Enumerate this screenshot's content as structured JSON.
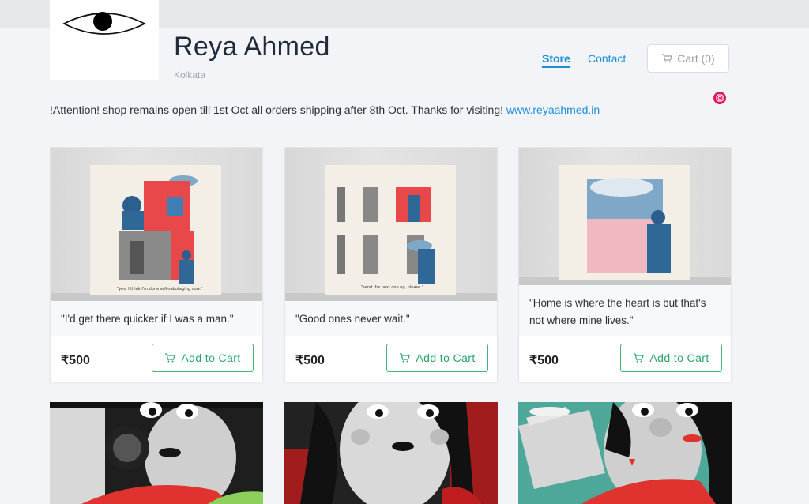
{
  "header": {
    "store_name": "Reya Ahmed",
    "city": "Kolkata",
    "nav": {
      "store": "Store",
      "contact": "Contact"
    },
    "cart_label": "Cart (0)"
  },
  "notice": {
    "text": "!Attention! shop remains open till 1st Oct all orders shipping after 8th Oct. Thanks for visiting! ",
    "link": "www.reyaahmed.in"
  },
  "products": [
    {
      "caption": "\"I'd get there quicker if I was a man.\"",
      "price": "₹500",
      "button": "Add to Cart",
      "art_text": "\"yes, I think I'm done self-sabotaging now.\""
    },
    {
      "caption": "\"Good ones never wait.\"",
      "price": "₹500",
      "button": "Add to Cart",
      "art_text": "\"send the next one up, please.\""
    },
    {
      "caption": "\"Home is where the heart is but that's not where mine lives.\"",
      "price": "₹500",
      "button": "Add to Cart",
      "art_text": ""
    }
  ],
  "colors": {
    "accent": "#1a8fd8",
    "button": "#2aa56a",
    "instagram": "#e2165d"
  },
  "icons": {
    "cart": "cart-icon",
    "instagram": "instagram-icon",
    "logo": "eye-logo-icon"
  }
}
